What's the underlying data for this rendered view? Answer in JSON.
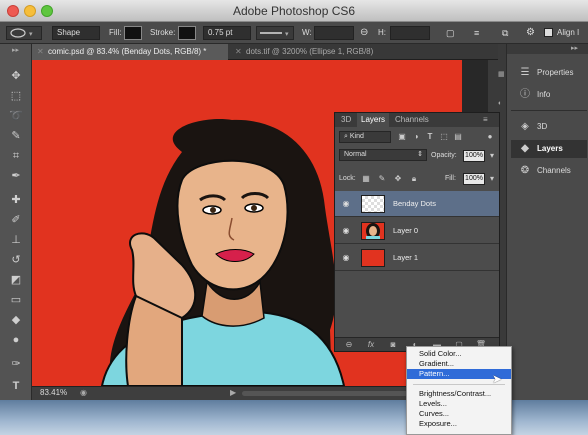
{
  "window": {
    "title": "Adobe Photoshop CS6"
  },
  "options_bar": {
    "tool_mode": "Shape",
    "fill_label": "Fill:",
    "stroke_label": "Stroke:",
    "stroke_width": "0.75 pt",
    "w_label": "W:",
    "h_label": "H:",
    "align_label": "Align I"
  },
  "tabs": [
    {
      "label": "comic.psd @ 83.4% (Benday Dots, RGB/8) *"
    },
    {
      "label": "dots.tif @ 3200% (Ellipse 1, RGB/8)"
    }
  ],
  "status": {
    "zoom": "83.41%"
  },
  "dock": {
    "items": [
      {
        "label": "Properties",
        "icon": "sliders-icon"
      },
      {
        "label": "Info",
        "icon": "info-icon"
      },
      {
        "label": "3D",
        "icon": "cube-icon"
      },
      {
        "label": "Layers",
        "icon": "layers-icon"
      },
      {
        "label": "Channels",
        "icon": "channels-icon"
      }
    ]
  },
  "layers_panel": {
    "tabs": [
      "3D",
      "Layers",
      "Channels"
    ],
    "filter": "Kind",
    "blend_mode": "Normal",
    "opacity_label": "Opacity:",
    "opacity": "100%",
    "lock_label": "Lock:",
    "fill_label": "Fill:",
    "fill": "100%",
    "layers": [
      {
        "name": "Benday Dots",
        "selected": true
      },
      {
        "name": "Layer 0",
        "selected": false
      },
      {
        "name": "Layer 1",
        "selected": false
      }
    ]
  },
  "context_menu": {
    "items": [
      "Solid Color...",
      "Gradient...",
      "Pattern...",
      "Brightness/Contrast...",
      "Levels...",
      "Curves...",
      "Exposure..."
    ],
    "highlighted": "Pattern..."
  },
  "colors": {
    "canvas_red": "#e1331f",
    "selection_blue": "#2f6bd8",
    "layer_selected": "#5d6f89"
  }
}
